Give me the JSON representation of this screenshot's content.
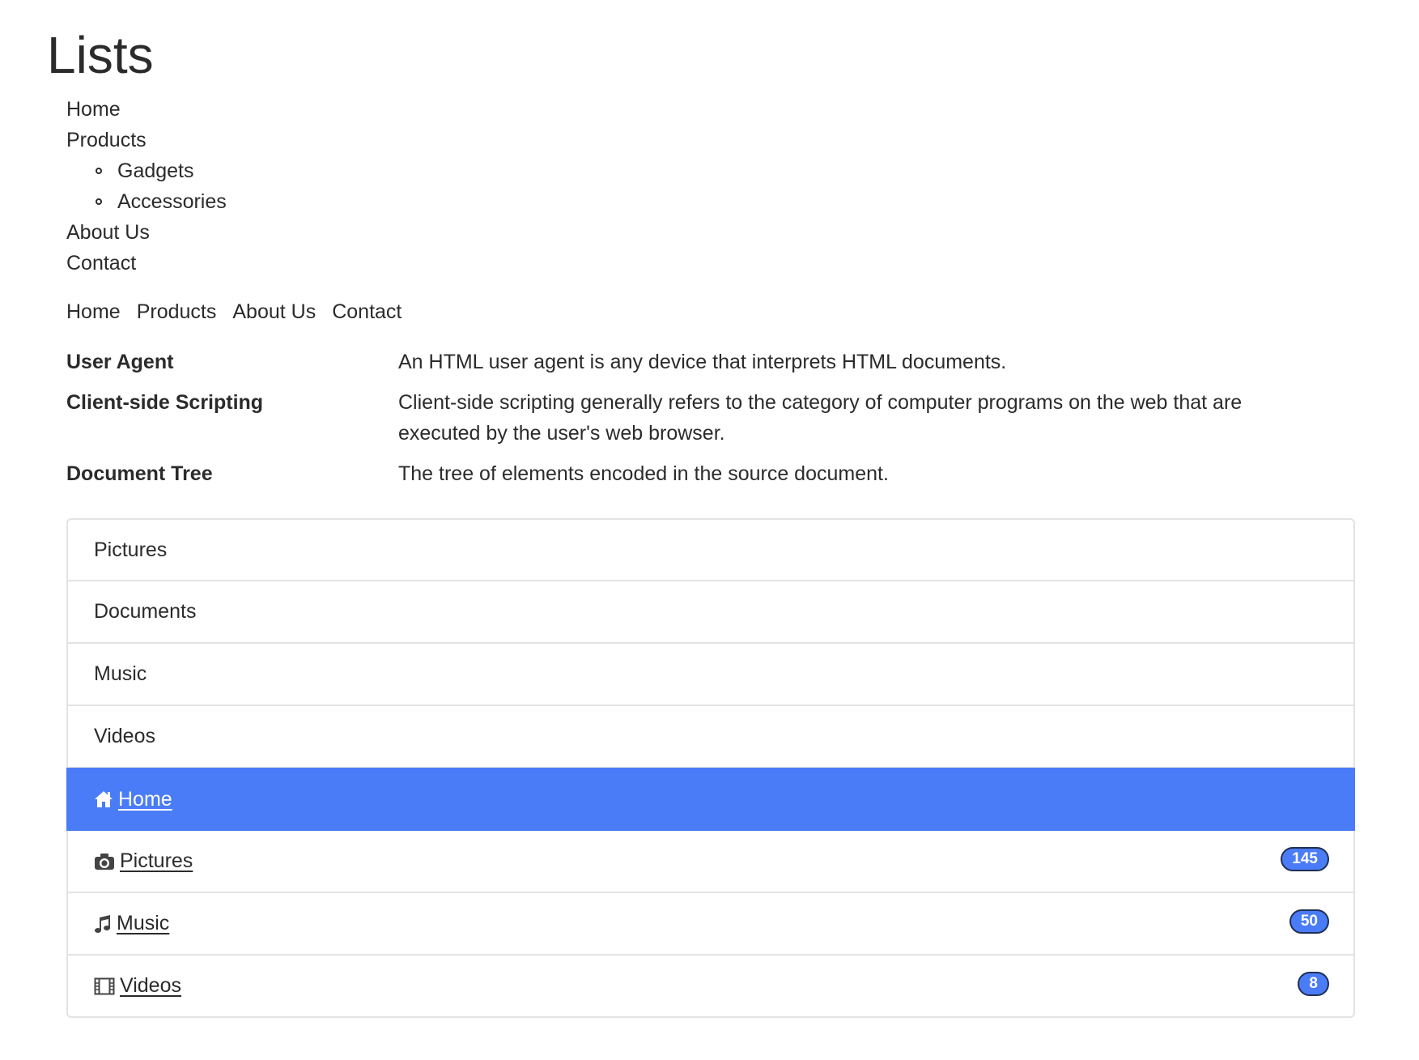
{
  "page": {
    "title": "Lists"
  },
  "nav_list": {
    "items": [
      {
        "label": "Home"
      },
      {
        "label": "Products",
        "children": [
          {
            "label": "Gadgets"
          },
          {
            "label": "Accessories"
          }
        ]
      },
      {
        "label": "About Us"
      },
      {
        "label": "Contact"
      }
    ]
  },
  "inline_nav": {
    "items": [
      "Home",
      "Products",
      "About Us",
      "Contact"
    ]
  },
  "definitions": [
    {
      "term": "User Agent",
      "description": "An HTML user agent is any device that interprets HTML documents."
    },
    {
      "term": "Client-side Scripting",
      "description": "Client-side scripting generally refers to the category of computer programs on the web that are executed by the user's web browser."
    },
    {
      "term": "Document Tree",
      "description": "The tree of elements encoded in the source document."
    }
  ],
  "list_group": {
    "items": [
      "Pictures",
      "Documents",
      "Music",
      "Videos"
    ]
  },
  "link_list_group": {
    "items": [
      {
        "label": "Home",
        "icon": "home-icon",
        "active": true
      },
      {
        "label": "Pictures",
        "icon": "camera-icon",
        "badge": "145"
      },
      {
        "label": "Music",
        "icon": "music-icon",
        "badge": "50"
      },
      {
        "label": "Videos",
        "icon": "film-icon",
        "badge": "8"
      }
    ]
  },
  "colors": {
    "accent": "#4a7cf7",
    "text": "#2b2b2b",
    "border": "#e3e3e3"
  }
}
